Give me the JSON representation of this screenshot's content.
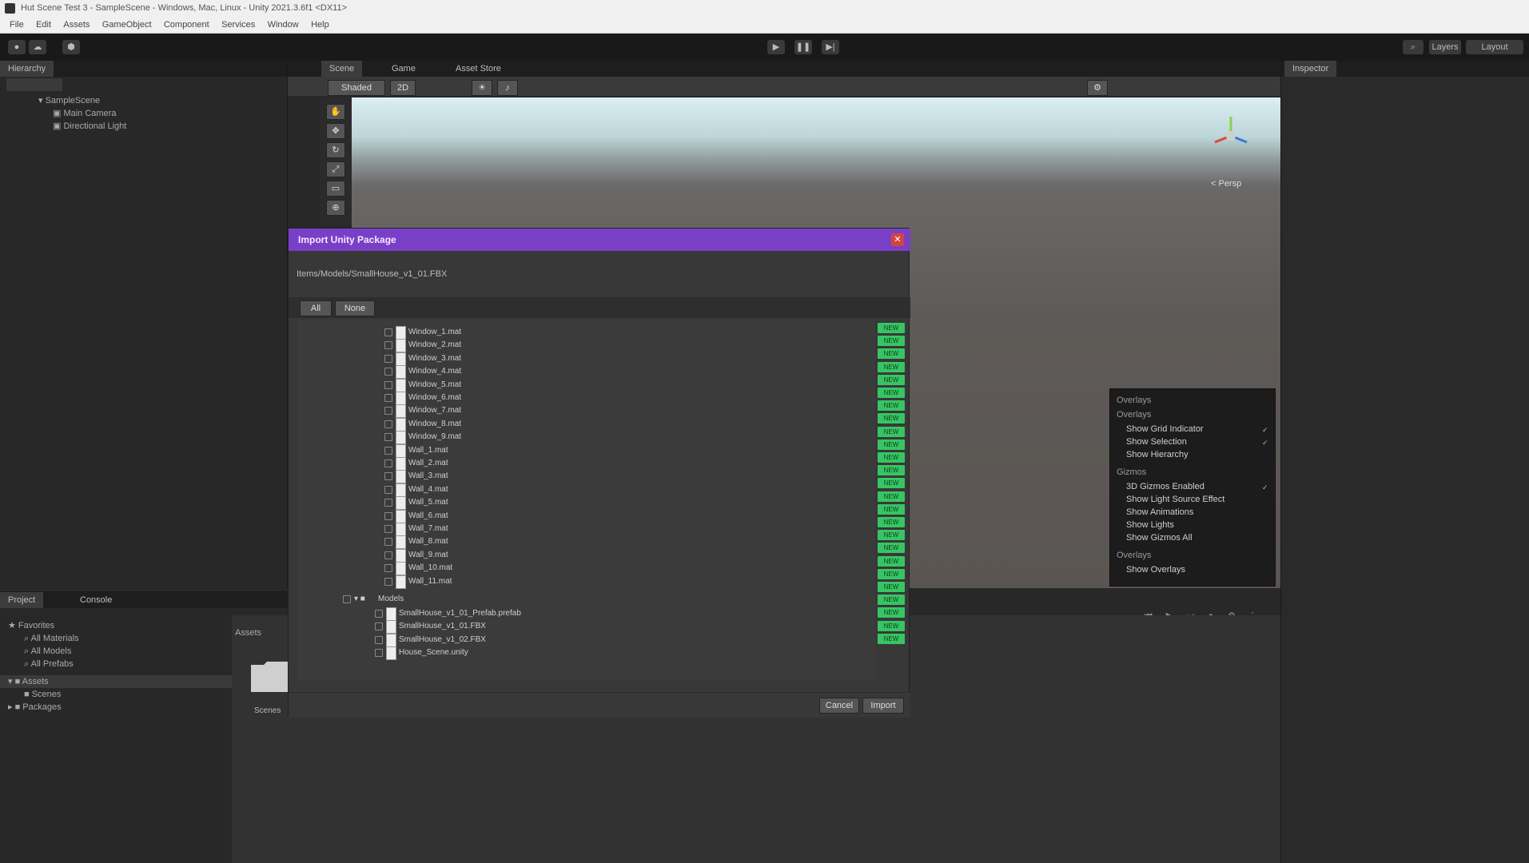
{
  "window": {
    "title": "Hut Scene Test 3 - SampleScene - Windows, Mac, Linux - Unity 2021.3.6f1 <DX11>"
  },
  "menu": [
    "File",
    "Edit",
    "Assets",
    "GameObject",
    "Component",
    "Services",
    "Window",
    "Help"
  ],
  "toolbar": {
    "account_label": "Account",
    "layers_label": "Layers",
    "layout_label": "Layout"
  },
  "hierarchy": {
    "tab": "Hierarchy",
    "items": [
      {
        "label": "SampleScene",
        "indent": 0
      },
      {
        "label": "Main Camera",
        "indent": 1
      },
      {
        "label": "Directional Light",
        "indent": 1
      }
    ]
  },
  "scene": {
    "tabs": [
      "Scene",
      "Game",
      "Asset Store"
    ],
    "shading_mode": "Shaded",
    "view_2d": "2D",
    "persp_label": "< Persp"
  },
  "inspector": {
    "tab": "Inspector"
  },
  "project": {
    "tabs": [
      "Project",
      "Console"
    ],
    "tree": [
      {
        "label": "Favorites",
        "indent": 0
      },
      {
        "label": "All Materials",
        "indent": 1
      },
      {
        "label": "All Models",
        "indent": 1
      },
      {
        "label": "All Prefabs",
        "indent": 1
      },
      {
        "label": "Assets",
        "indent": 0
      },
      {
        "label": "Scenes",
        "indent": 1
      },
      {
        "label": "Packages",
        "indent": 0
      }
    ],
    "breadcrumb": "Assets",
    "folder_label": "Scenes"
  },
  "overlay_menu": {
    "title": "Overlays",
    "rows": [
      {
        "label": "Overlays",
        "header": true
      },
      {
        "label": "Show Grid Indicator",
        "checked": true
      },
      {
        "label": "Show Selection",
        "checked": true
      },
      {
        "label": "Show Hierarchy",
        "checked": false
      },
      {
        "label": "Gizmos",
        "header": true
      },
      {
        "label": "3D Gizmos Enabled",
        "checked": true
      },
      {
        "label": "Show Light Source Effect",
        "checked": false
      },
      {
        "label": "Show Animations",
        "checked": false
      },
      {
        "label": "Show Lights",
        "checked": false
      },
      {
        "label": "Show Gizmos All",
        "checked": false
      },
      {
        "label": "Overlays",
        "header": true
      },
      {
        "label": "Show Overlays",
        "checked": false
      }
    ]
  },
  "dialog": {
    "title": "Import Unity Package",
    "path": "Items/Models/SmallHouse_v1_01.FBX",
    "filter_buttons": [
      "All",
      "None"
    ],
    "files": [
      "Window_1.mat",
      "Window_2.mat",
      "Window_3.mat",
      "Window_4.mat",
      "Window_5.mat",
      "Window_6.mat",
      "Window_7.mat",
      "Window_8.mat",
      "Window_9.mat",
      "Wall_1.mat",
      "Wall_2.mat",
      "Wall_3.mat",
      "Wall_4.mat",
      "Wall_5.mat",
      "Wall_6.mat",
      "Wall_7.mat",
      "Wall_8.mat",
      "Wall_9.mat",
      "Wall_10.mat",
      "Wall_11.mat"
    ],
    "folder_name": "Models",
    "subfiles": [
      "SmallHouse_v1_01_Prefab.prefab",
      "SmallHouse_v1_01.FBX",
      "SmallHouse_v1_02.FBX",
      "House_Scene.unity"
    ],
    "new_badge": "NEW",
    "cancel_label": "Cancel",
    "import_label": "Import"
  },
  "colors": {
    "dialog_title": "#7a3fc7",
    "new_badge": "#37c564",
    "close": "#d2453f"
  }
}
